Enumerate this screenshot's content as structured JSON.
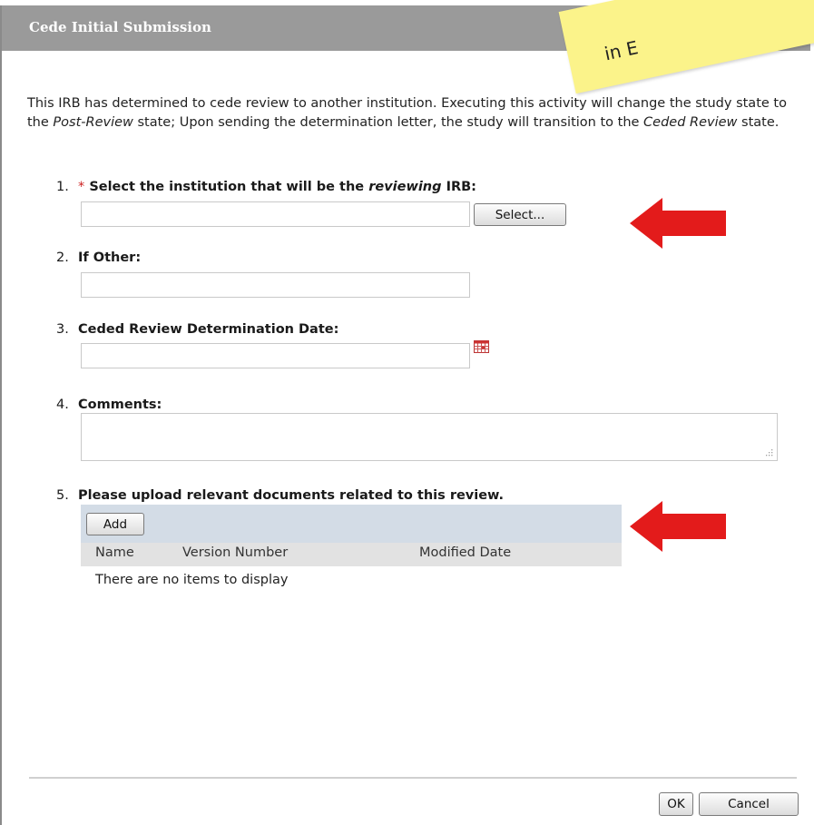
{
  "dialog": {
    "title": "Cede Initial Submission"
  },
  "sticky_note": {
    "text": "in E"
  },
  "intro": {
    "text_1": "This IRB has determined to cede review to another institution.  Executing this activity will change the study state to the ",
    "em_1": "Post-Review",
    "text_2": " state; Upon sending the determination letter, the study will transition to the ",
    "em_2": "Ceded Review",
    "text_3": " state."
  },
  "q1": {
    "num": "1.",
    "required_mark": "*",
    "label_pre": "Select the institution that will be the ",
    "label_em": "reviewing",
    "label_post": " IRB:",
    "value": "",
    "select_label": "Select..."
  },
  "q2": {
    "num": "2.",
    "label": "If Other:",
    "value": ""
  },
  "q3": {
    "num": "3.",
    "label": "Ceded Review Determination Date:",
    "value": ""
  },
  "q4": {
    "num": "4.",
    "label": "Comments:",
    "value": ""
  },
  "q5": {
    "num": "5.",
    "label": "Please upload relevant documents related to this review.",
    "add_label": "Add",
    "columns": [
      "Name",
      "Version Number",
      "Modified Date"
    ],
    "empty_text": "There are no items to display"
  },
  "footer": {
    "ok_label": "OK",
    "cancel_label": "Cancel"
  },
  "colors": {
    "titlebar": "#9a9a9a",
    "required": "#cc2222",
    "annotation_arrow": "#e31b1b",
    "sticky_note": "#fbf38a"
  }
}
